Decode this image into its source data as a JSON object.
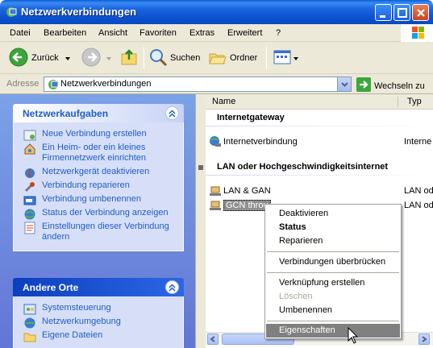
{
  "window": {
    "title": "Netzwerkverbindungen"
  },
  "menu": [
    "Datei",
    "Bearbeiten",
    "Ansicht",
    "Favoriten",
    "Extras",
    "Erweitert",
    "?"
  ],
  "toolbar": {
    "back": "Zurück",
    "search": "Suchen",
    "folders": "Ordner"
  },
  "address": {
    "label": "Adresse",
    "value": "Netzwerkverbindungen",
    "go": "Wechseln zu"
  },
  "tasks": {
    "title": "Netzwerkaufgaben",
    "items": [
      "Neue Verbindung erstellen",
      "Ein Heim- oder ein kleines Firmennetzwerk einrichten",
      "Netzwerkgerät deaktivieren",
      "Verbindung reparieren",
      "Verbindung umbenennen",
      "Status der Verbindung anzeigen",
      "Einstellungen dieser Verbindung ändern"
    ]
  },
  "other": {
    "title": "Andere Orte",
    "items": [
      "Systemsteuerung",
      "Netzwerkumgebung",
      "Eigene Dateien"
    ]
  },
  "list": {
    "columns": [
      "Name",
      "Typ"
    ],
    "groups": [
      {
        "title": "Internetgateway",
        "rows": [
          {
            "name": "Internetverbindung",
            "type": "Interne"
          }
        ]
      },
      {
        "title": "LAN oder Hochgeschwindigkeitsinternet",
        "rows": [
          {
            "name": "LAN & GAN",
            "type": "LAN od"
          },
          {
            "name": "GCN throu",
            "type": "LAN od"
          }
        ]
      }
    ]
  },
  "context_menu": {
    "items": [
      "Deaktivieren",
      "Status",
      "Reparieren",
      "Verbindungen überbrücken",
      "Verknüpfung erstellen",
      "Löschen",
      "Umbenennen",
      "Eigenschaften"
    ]
  }
}
